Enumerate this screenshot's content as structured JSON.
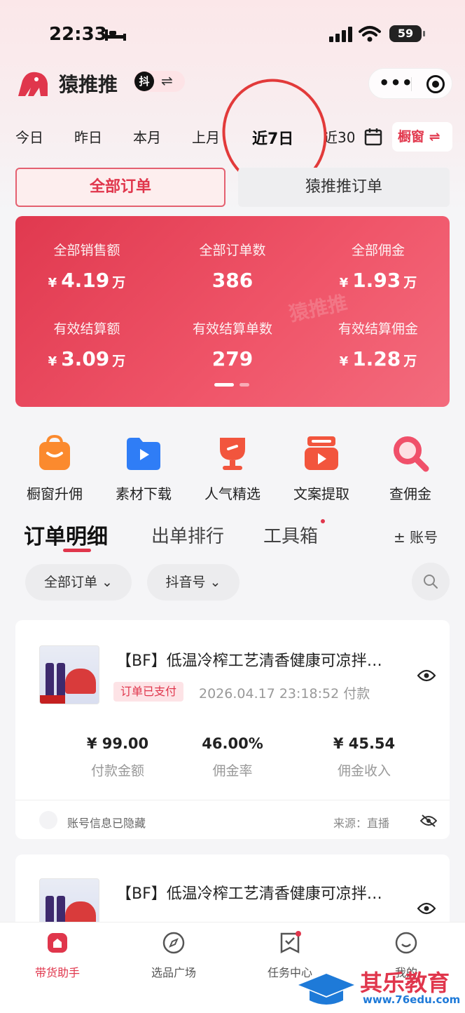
{
  "status_bar": {
    "time": "22:33",
    "battery": "59"
  },
  "header": {
    "app_title": "猿推推",
    "douyin_badge": "抖",
    "switch_symbol": "⇌",
    "more_symbol": "•••"
  },
  "date_tabs": [
    "今日",
    "昨日",
    "本月",
    "上月",
    "近7日",
    "近30"
  ],
  "date_tabs_active": "近7日",
  "shop_toggle": "橱窗 ⇌",
  "order_type": {
    "all": "全部订单",
    "ytt": "猿推推订单"
  },
  "stats": {
    "watermark": "猿推推",
    "currency": "¥",
    "unit": "万",
    "items": [
      {
        "label": "全部销售额",
        "value": "4.19",
        "money": true
      },
      {
        "label": "全部订单数",
        "value": "386",
        "money": false
      },
      {
        "label": "全部佣金",
        "value": "1.93",
        "money": true
      },
      {
        "label": "有效结算额",
        "value": "3.09",
        "money": true
      },
      {
        "label": "有效结算单数",
        "value": "279",
        "money": false
      },
      {
        "label": "有效结算佣金",
        "value": "1.28",
        "money": true
      }
    ]
  },
  "quick_actions": [
    {
      "label": "橱窗升佣",
      "icon": "shopping-bag-icon",
      "color": "#fb8a2e"
    },
    {
      "label": "素材下载",
      "icon": "video-folder-icon",
      "color": "#2f7df6"
    },
    {
      "label": "人气精选",
      "icon": "trophy-icon",
      "color": "#f2553d"
    },
    {
      "label": "文案提取",
      "icon": "text-extract-icon",
      "color": "#f2553d"
    },
    {
      "label": "查佣金",
      "icon": "magnifier-icon",
      "color": "#f0506a"
    }
  ],
  "section_tabs": {
    "detail": "订单明细",
    "ranking": "出单排行",
    "toolbox": "工具箱",
    "account": "± 账号"
  },
  "filters": {
    "all_orders": "全部订单 ⌄",
    "douyin_id": "抖音号 ⌄"
  },
  "orders": [
    {
      "title": "【BF】低温冷榨工艺清香健康可凉拌…",
      "status": "订单已支付",
      "time": "2026.04.17 23:18:52 付款",
      "amount": "¥ 99.00",
      "amount_label": "付款金额",
      "rate": "46.00%",
      "rate_label": "佣金率",
      "income": "¥ 45.54",
      "income_label": "佣金收入",
      "account": "账号信息已隐藏",
      "source": "来源：直播"
    },
    {
      "title": "【BF】低温冷榨工艺清香健康可凉拌…"
    }
  ],
  "bottom_nav": [
    {
      "label": "带货助手",
      "icon": "home-icon"
    },
    {
      "label": "选品广场",
      "icon": "compass-icon"
    },
    {
      "label": "任务中心",
      "icon": "task-icon"
    },
    {
      "label": "我的",
      "icon": "profile-icon"
    }
  ],
  "brand_watermark": {
    "name": "其乐教育",
    "url": "www.76edu.com"
  },
  "colors": {
    "accent": "#e0364c",
    "annotation_circle": "#e23a3a"
  }
}
